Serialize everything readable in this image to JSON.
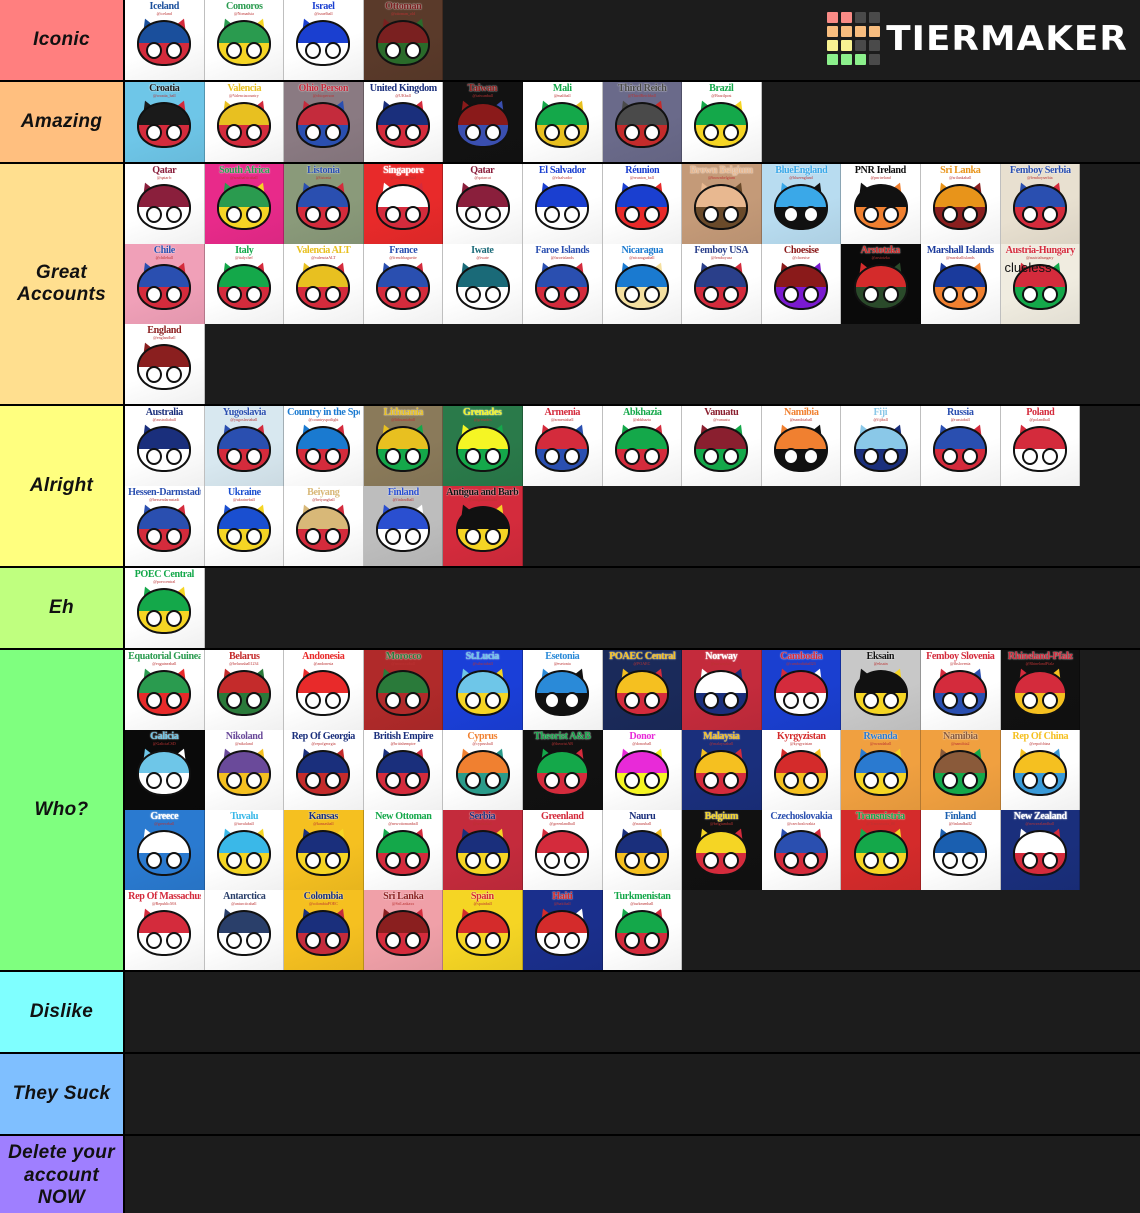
{
  "app": {
    "name": "TierMaker",
    "logo_text": "TIERMAKER",
    "logo_colors": [
      [
        "#f98b86",
        "#f98b86",
        "#4a4a4a",
        "#4a4a4a"
      ],
      [
        "#f8bd7f",
        "#f8bd7f",
        "#f8bd7f",
        "#f8bd7f"
      ],
      [
        "#f8f292",
        "#f8f292",
        "#4a4a4a",
        "#4a4a4a"
      ],
      [
        "#8cf08c",
        "#8cf08c",
        "#8cf08c",
        "#4a4a4a"
      ]
    ],
    "background": "#1a1a1a"
  },
  "tiers": [
    {
      "label": "Iconic",
      "color": "#ff7f7f",
      "items": [
        {
          "name": "Iceland",
          "sub": "@iceland",
          "bg": "#ffffff",
          "accent": "#1a4f9c",
          "accent2": "#d42b3c"
        },
        {
          "name": "Comoros",
          "sub": "@Nomadsia",
          "bg": "#ffffff",
          "accent": "#2a9b4f",
          "accent2": "#f5d524"
        },
        {
          "name": "Israel",
          "sub": "@israelball",
          "bg": "#ffffff",
          "accent": "#1a3fd0",
          "accent2": "#ffffff"
        },
        {
          "name": "Ottoman",
          "sub": "@ottoman_old",
          "bg": "#5a3a2a",
          "accent": "#7a2020",
          "accent2": "#2a6b2a"
        }
      ]
    },
    {
      "label": "Amazing",
      "color": "#ffbf7f",
      "items": [
        {
          "name": "Croatia",
          "sub": "@croatia_ball",
          "bg": "#6ec6e8",
          "accent": "#1a1a1a",
          "accent2": "#d42b3c"
        },
        {
          "name": "Valencia",
          "sub": "@Valenciacountry",
          "bg": "#ffffff",
          "accent": "#e8c020",
          "accent2": "#d42b3c"
        },
        {
          "name": "Ohio Person",
          "sub": "@ohioperson",
          "bg": "#8a7a82",
          "accent": "#c42b3c",
          "accent2": "#2a4fb0"
        },
        {
          "name": "United Kingdom",
          "sub": "@UKball",
          "bg": "#ffffff",
          "accent": "#1a2f7c",
          "accent2": "#d42b3c"
        },
        {
          "name": "Taiwan",
          "sub": "@taiwanball",
          "bg": "#121212",
          "accent": "#8a1a1a",
          "accent2": "#3a4fb0"
        },
        {
          "name": "Mali",
          "sub": "@maliball",
          "bg": "#ffffff",
          "accent": "#14a84a",
          "accent2": "#e8c020"
        },
        {
          "name": "Third Reich",
          "sub": "@ThirdReichball",
          "bg": "#6a6a8a",
          "accent": "#4a4a4a",
          "accent2": "#c42b2b"
        },
        {
          "name": "Brazil",
          "sub": "@Brazilpost",
          "bg": "#ffffff",
          "accent": "#14a84a",
          "accent2": "#f5d524"
        }
      ]
    },
    {
      "label": "Great Accounts",
      "color": "#ffdf8f",
      "items": [
        {
          "name": "Qatar",
          "sub": "@qatarfc",
          "bg": "#ffffff",
          "accent": "#8a1f3c",
          "accent2": "#ffffff"
        },
        {
          "name": "South Africa",
          "sub": "@southafricaball",
          "bg": "#e82a8a",
          "accent": "#2a9b4f",
          "accent2": "#f5d524"
        },
        {
          "name": "Listonia",
          "sub": "@listonia",
          "bg": "#8a9a7a",
          "accent": "#2a4fb0",
          "accent2": "#d42b3c"
        },
        {
          "name": "Singapore",
          "sub": "@singaporeball",
          "bg": "#e82a2a",
          "accent": "#ffffff",
          "accent2": "#d42b3c"
        },
        {
          "name": "Qatar",
          "sub": "@qatarcat",
          "bg": "#ffffff",
          "accent": "#8a1f3c",
          "accent2": "#ffffff"
        },
        {
          "name": "El Salvador",
          "sub": "@elsalvador",
          "bg": "#ffffff",
          "accent": "#1a3fd0",
          "accent2": "#ffffff"
        },
        {
          "name": "Réunion",
          "sub": "@reunion_ball",
          "bg": "#ffffff",
          "accent": "#1a3fd0",
          "accent2": "#e82a2a"
        },
        {
          "name": "Brown Belgium",
          "sub": "@brownbelgium",
          "bg": "#c49a78",
          "accent": "#e8b890",
          "accent2": "#6a4a2a"
        },
        {
          "name": "BlueEngland",
          "sub": "@blueengland",
          "bg": "#b8dcf0",
          "accent": "#3aa8e8",
          "accent2": "#111111"
        },
        {
          "name": "PNR Ireland",
          "sub": "@pnrireland",
          "bg": "#ffffff",
          "accent": "#111111",
          "accent2": "#f08030"
        },
        {
          "name": "Sri Lanka",
          "sub": "@srilankaball",
          "bg": "#ffffff",
          "accent": "#e8941a",
          "accent2": "#8a1f1f"
        },
        {
          "name": "Femboy Serbia",
          "sub": "@femboyserbia",
          "bg": "#e8e0d0",
          "accent": "#2a4fb0",
          "accent2": "#d42b3c"
        },
        {
          "name": "Chile",
          "sub": "@chileball",
          "bg": "#f0a0b8",
          "accent": "#2a4fb0",
          "accent2": "#d42b3c"
        },
        {
          "name": "Italy",
          "sub": "@italychef",
          "bg": "#ffffff",
          "accent": "#14a84a",
          "accent2": "#d42b3c"
        },
        {
          "name": "Valencia ALT",
          "sub": "@valenciaALT",
          "bg": "#ffffff",
          "accent": "#e8c020",
          "accent2": "#d42b3c"
        },
        {
          "name": "France",
          "sub": "@frenchbaguette",
          "bg": "#ffffff",
          "accent": "#2a4fb0",
          "accent2": "#d42b3c"
        },
        {
          "name": "Iwate",
          "sub": "@iwate",
          "bg": "#ffffff",
          "accent": "#1a6a78",
          "accent2": "#ffffff"
        },
        {
          "name": "Faroe Islands",
          "sub": "@faroeislands",
          "bg": "#ffffff",
          "accent": "#2a4fb0",
          "accent2": "#d42b3c"
        },
        {
          "name": "Nicaragua",
          "sub": "@nicaraguaball",
          "bg": "#ffffff",
          "accent": "#1a7ad0",
          "accent2": "#f5e0a0"
        },
        {
          "name": "Femboy USA",
          "sub": "@femboyusa",
          "bg": "#ffffff",
          "accent": "#2a3f8a",
          "accent2": "#d42b3c"
        },
        {
          "name": "Choesise",
          "sub": "@choesise",
          "bg": "#ffffff",
          "accent": "#8a1a1a",
          "accent2": "#7a1ad0"
        },
        {
          "name": "Arstotzka",
          "sub": "@arstotzka",
          "bg": "#0a0a0a",
          "accent": "#d42b2b",
          "accent2": "#2a4a2a"
        },
        {
          "name": "Marshall Islands",
          "sub": "@marshallislands",
          "bg": "#ffffff",
          "accent": "#1a3a9c",
          "accent2": "#f08030"
        },
        {
          "name": "Austria-Hungary",
          "sub": "@austriahungary",
          "bg": "#f0ece0",
          "accent": "#d42b3c",
          "accent2": "#14a84a",
          "overlay_text": "clueless"
        },
        {
          "name": "England",
          "sub": "@englandball",
          "bg": "#ffffff",
          "accent": "#8a1f1f",
          "accent2": "#ffffff"
        }
      ]
    },
    {
      "label": "Alright",
      "color": "#ffff7f",
      "items": [
        {
          "name": "Australia",
          "sub": "@australiaball",
          "bg": "#ffffff",
          "accent": "#1a2f7c",
          "accent2": "#ffffff"
        },
        {
          "name": "Yugoslavia",
          "sub": "@yugoslaviaball",
          "bg": "#d8e8f0",
          "accent": "#2a4fb0",
          "accent2": "#d42b3c"
        },
        {
          "name": "Country in the Spotlight",
          "sub": "@countryspotlight",
          "bg": "#ffffff",
          "accent": "#1a7ad0",
          "accent2": "#d42b3c"
        },
        {
          "name": "Lithuania",
          "sub": "@lithuaniaball",
          "bg": "#8a7a5a",
          "accent": "#e8c020",
          "accent2": "#14a84a"
        },
        {
          "name": "Grenades",
          "sub": "@grenades",
          "bg": "#2a7a4a",
          "accent": "#f5f524",
          "accent2": "#14a84a"
        },
        {
          "name": "Armenia",
          "sub": "@armeniaball",
          "bg": "#ffffff",
          "accent": "#d42b3c",
          "accent2": "#2a4fb0"
        },
        {
          "name": "Abkhazia",
          "sub": "@abkhazia",
          "bg": "#ffffff",
          "accent": "#14a84a",
          "accent2": "#d42b3c"
        },
        {
          "name": "Vanuatu",
          "sub": "@vanuatu",
          "bg": "#ffffff",
          "accent": "#8a1f2f",
          "accent2": "#14a84a"
        },
        {
          "name": "Namibia",
          "sub": "@namibiaball",
          "bg": "#ffffff",
          "accent": "#f08030",
          "accent2": "#111111"
        },
        {
          "name": "Fiji",
          "sub": "@fijiball",
          "bg": "#ffffff",
          "accent": "#8ac8e8",
          "accent2": "#1a2f7c"
        },
        {
          "name": "Russia",
          "sub": "@russiaball",
          "bg": "#ffffff",
          "accent": "#2a4fb0",
          "accent2": "#d42b3c"
        },
        {
          "name": "Poland",
          "sub": "@polandball",
          "bg": "#ffffff",
          "accent": "#d42b3c",
          "accent2": "#ffffff"
        },
        {
          "name": "Hessen-Darmstadt",
          "sub": "@hessendarmstadt",
          "bg": "#ffffff",
          "accent": "#2a4fb0",
          "accent2": "#d42b3c"
        },
        {
          "name": "Ukraine",
          "sub": "@ukraineball",
          "bg": "#ffffff",
          "accent": "#1a4fd0",
          "accent2": "#f5d524"
        },
        {
          "name": "Beiyang",
          "sub": "@beiyangball",
          "bg": "#ffffff",
          "accent": "#d8b878",
          "accent2": "#d42b3c"
        },
        {
          "name": "Finland",
          "sub": "@finlandball",
          "bg": "#bdbdbd",
          "accent": "#2a4fd0",
          "accent2": "#ffffff"
        },
        {
          "name": "Antigua and Barbuda",
          "sub": "@antiguabarbuda",
          "bg": "#d42b3c",
          "accent": "#111111",
          "accent2": "#f5d524"
        }
      ]
    },
    {
      "label": "Eh",
      "color": "#bfff7f",
      "items": [
        {
          "name": "POEC Central",
          "sub": "@poeccentral",
          "bg": "#ffffff",
          "accent": "#14a84a",
          "accent2": "#f5d524"
        }
      ]
    },
    {
      "label": "Who?",
      "color": "#7fff7f",
      "items": [
        {
          "name": "Equatorial Guinea",
          "sub": "@eqguineaball",
          "bg": "#ffffff",
          "accent": "#2a9b4f",
          "accent2": "#e82a2a"
        },
        {
          "name": "Belarus",
          "sub": "@belarusball1234",
          "bg": "#ffffff",
          "accent": "#c42b2b",
          "accent2": "#2a7a3a"
        },
        {
          "name": "Andonesia",
          "sub": "@andonesia",
          "bg": "#ffffff",
          "accent": "#e82a2a",
          "accent2": "#ffffff"
        },
        {
          "name": "Morocco",
          "sub": "@moroccoball",
          "bg": "#b02a2a",
          "accent": "#2a7a3a",
          "accent2": "#b02a2a"
        },
        {
          "name": "St.Lucia",
          "sub": "@stluciaball",
          "bg": "#1a3fd8",
          "accent": "#6ec6e8",
          "accent2": "#f5d524"
        },
        {
          "name": "Esetonia",
          "sub": "@esetonia",
          "bg": "#ffffff",
          "accent": "#2a8ad8",
          "accent2": "#111111"
        },
        {
          "name": "POAEC Central",
          "sub": "@POAEC",
          "bg": "#1a2a5a",
          "accent": "#f5c020",
          "accent2": "#d42b3c"
        },
        {
          "name": "Norway",
          "sub": "@norwayball",
          "bg": "#c42b3c",
          "accent": "#ffffff",
          "accent2": "#1a2f7c"
        },
        {
          "name": "Cambodia",
          "sub": "@cambodiaball23",
          "bg": "#1a3fd0",
          "accent": "#d42b3c",
          "accent2": "#ffffff"
        },
        {
          "name": "Eksain",
          "sub": "@eksain",
          "bg": "#c8c8c8",
          "accent": "#111111",
          "accent2": "#f5d524"
        },
        {
          "name": "Femboy Slovenia",
          "sub": "@fbslovenia",
          "bg": "#ffffff",
          "accent": "#d42b3c",
          "accent2": "#2a4fb0"
        },
        {
          "name": "Rhineland-Pfalz",
          "sub": "@RhinelandPfalz",
          "bg": "#111111",
          "accent": "#d42b3c",
          "accent2": "#f5c020"
        },
        {
          "name": "Galicia",
          "sub": "@GaliciaCSD",
          "bg": "#0a0a0a",
          "accent": "#6ec6e8",
          "accent2": "#ffffff"
        },
        {
          "name": "Nikoland",
          "sub": "@nikoland",
          "bg": "#ffffff",
          "accent": "#6a4a9a",
          "accent2": "#f5c020"
        },
        {
          "name": "Rep Of Georgia",
          "sub": "@repofgeorgia",
          "bg": "#ffffff",
          "accent": "#1a2f7c",
          "accent2": "#c42b2b"
        },
        {
          "name": "British Empire",
          "sub": "@britishempire",
          "bg": "#ffffff",
          "accent": "#1a2f7c",
          "accent2": "#d42b3c"
        },
        {
          "name": "Cyprus",
          "sub": "@cyprusball",
          "bg": "#ffffff",
          "accent": "#f08030",
          "accent2": "#2a9b8a"
        },
        {
          "name": "Theorist A&B",
          "sub": "@theoristAB",
          "bg": "#111111",
          "accent": "#14a84a",
          "accent2": "#d42b3c"
        },
        {
          "name": "Donor",
          "sub": "@donorball",
          "bg": "#ffffff",
          "accent": "#e82ad8",
          "accent2": "#f5f524"
        },
        {
          "name": "Malaysia",
          "sub": "@malaysiaball",
          "bg": "#1a2f7c",
          "accent": "#f5c020",
          "accent2": "#d42b3c"
        },
        {
          "name": "Kyrgyzistan",
          "sub": "@kyrgyzistan",
          "bg": "#ffffff",
          "accent": "#d42b2b",
          "accent2": "#f5c020"
        },
        {
          "name": "Rwanda",
          "sub": "@rwandaball",
          "bg": "#f0a040",
          "accent": "#2a7ad0",
          "accent2": "#f5d524"
        },
        {
          "name": "Namibia",
          "sub": "@namibia2",
          "bg": "#f0a040",
          "accent": "#8a5a3a",
          "accent2": "#14a84a"
        },
        {
          "name": "Rep Of China",
          "sub": "@repofchina",
          "bg": "#ffffff",
          "accent": "#f5c020",
          "accent2": "#3a9ad8"
        },
        {
          "name": "Greece",
          "sub": "@greeceball",
          "bg": "#2a7ad0",
          "accent": "#ffffff",
          "accent2": "#2a7ad0"
        },
        {
          "name": "Tuvalu",
          "sub": "@tuvaluball",
          "bg": "#ffffff",
          "accent": "#3ab8e8",
          "accent2": "#f5d524"
        },
        {
          "name": "Kansas",
          "sub": "@kansasball",
          "bg": "#f5c020",
          "accent": "#1a2f7c",
          "accent2": "#f5d524"
        },
        {
          "name": "New Ottoman",
          "sub": "@newottomanball",
          "bg": "#ffffff",
          "accent": "#14a84a",
          "accent2": "#d42b3c"
        },
        {
          "name": "Serbia",
          "sub": "@serbiaball",
          "bg": "#c42b3c",
          "accent": "#1a2f7c",
          "accent2": "#f5d524"
        },
        {
          "name": "Greenland",
          "sub": "@greenlandball",
          "bg": "#ffffff",
          "accent": "#d42b3c",
          "accent2": "#ffffff"
        },
        {
          "name": "Nauru",
          "sub": "@nauruball",
          "bg": "#ffffff",
          "accent": "#1a2f7c",
          "accent2": "#f5c020"
        },
        {
          "name": "Belgium",
          "sub": "@belgiumball",
          "bg": "#111111",
          "accent": "#f5d524",
          "accent2": "#d42b3c"
        },
        {
          "name": "Czechoslovakia",
          "sub": "@czechoslovakia",
          "bg": "#ffffff",
          "accent": "#2a4fb0",
          "accent2": "#d42b3c"
        },
        {
          "name": "Transnistria",
          "sub": "@Transnistria_80",
          "bg": "#d42b2b",
          "accent": "#14a84a",
          "accent2": "#f5d524"
        },
        {
          "name": "Finland",
          "sub": "@finlandball2",
          "bg": "#ffffff",
          "accent": "#1a5fb0",
          "accent2": "#ffffff"
        },
        {
          "name": "New Zealand",
          "sub": "@newzealandball",
          "bg": "#1a2f7c",
          "accent": "#ffffff",
          "accent2": "#d42b3c"
        },
        {
          "name": "Rep Of Massachusetts",
          "sub": "@RepublicMA",
          "bg": "#ffffff",
          "accent": "#d42b3c",
          "accent2": "#ffffff"
        },
        {
          "name": "Antarctica",
          "sub": "@antarcticaball",
          "bg": "#ffffff",
          "accent": "#2a3f6a",
          "accent2": "#ffffff"
        },
        {
          "name": "Colombia",
          "sub": "@colombiaPOEC",
          "bg": "#f5c020",
          "accent": "#1a2f7c",
          "accent2": "#c42b3c"
        },
        {
          "name": "Sri Lanka",
          "sub": "@SriLankaxx",
          "bg": "#f0a0a8",
          "accent": "#8a1f1f",
          "accent2": "#d42b3c"
        },
        {
          "name": "Spain",
          "sub": "@spainball",
          "bg": "#f5d524",
          "accent": "#d42b2b",
          "accent2": "#f5d524"
        },
        {
          "name": "Haiti",
          "sub": "@haitiball",
          "bg": "#1a2f8c",
          "accent": "#d42b2b",
          "accent2": "#ffffff"
        },
        {
          "name": "Turkmenistan",
          "sub": "@turkmenball",
          "bg": "#ffffff",
          "accent": "#14a84a",
          "accent2": "#d42b3c"
        }
      ]
    },
    {
      "label": "Dislike",
      "color": "#7fffff",
      "items": []
    },
    {
      "label": "They Suck",
      "color": "#7fbfff",
      "items": []
    },
    {
      "label": "Delete your account NOW",
      "color": "#9f7fff",
      "items": []
    }
  ]
}
